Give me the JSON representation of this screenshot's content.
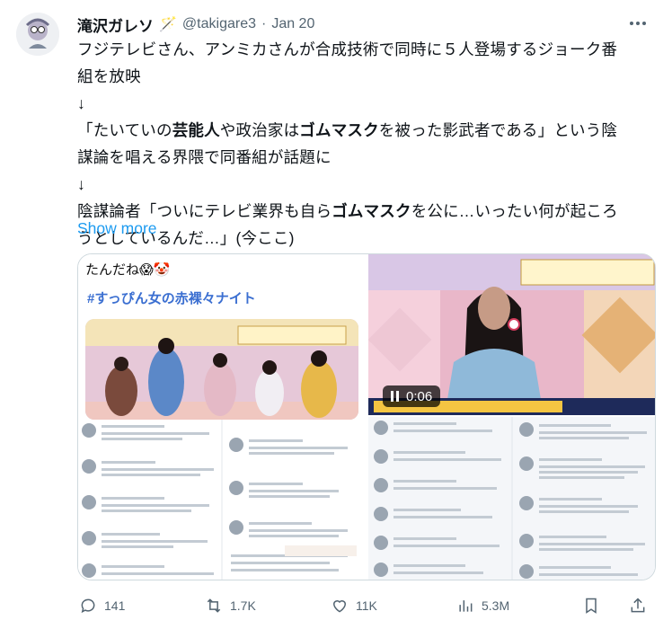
{
  "author": {
    "name": "滝沢ガレソ",
    "name_suffix": "🪄",
    "handle": "@takigare3",
    "separator": "·",
    "date": "Jan 20"
  },
  "tweet": {
    "lines": [
      {
        "parts": [
          {
            "t": "フジテレビさん、アンミカさんが合成技術で同時に５人登場するジョーク番"
          }
        ]
      },
      {
        "parts": [
          {
            "t": "組を放映"
          }
        ]
      },
      {
        "parts": [
          {
            "t": "↓"
          }
        ]
      },
      {
        "parts": [
          {
            "t": "「たいていの"
          },
          {
            "t": "芸能人",
            "b": true
          },
          {
            "t": "や政治家は"
          },
          {
            "t": "ゴムマスク",
            "b": true
          },
          {
            "t": "を被った影武者である」という陰"
          }
        ]
      },
      {
        "parts": [
          {
            "t": "謀論を唱える界隈で同番組が話題に"
          }
        ]
      },
      {
        "parts": [
          {
            "t": "↓"
          }
        ]
      },
      {
        "parts": [
          {
            "t": "陰謀論者「ついにテレビ業界も自ら"
          },
          {
            "t": "ゴムマスク",
            "b": true
          },
          {
            "t": "を公に…いったい何が起ころ"
          }
        ]
      },
      {
        "parts": [
          {
            "t": "うとしているんだ…」(今ここ)"
          }
        ]
      }
    ],
    "show_more": "Show more"
  },
  "media": {
    "left_caption": "たんだね😱🤡",
    "left_hashtag": "#すっぴん女の赤裸々ナイト",
    "video_time": "0:06"
  },
  "actions": {
    "replies": "141",
    "reposts": "1.7K",
    "likes": "11K",
    "views": "5.3M"
  },
  "colors": {
    "link": "#1d9bf0",
    "text": "#0f1419",
    "muted": "#536471",
    "border": "#cfd9de"
  }
}
